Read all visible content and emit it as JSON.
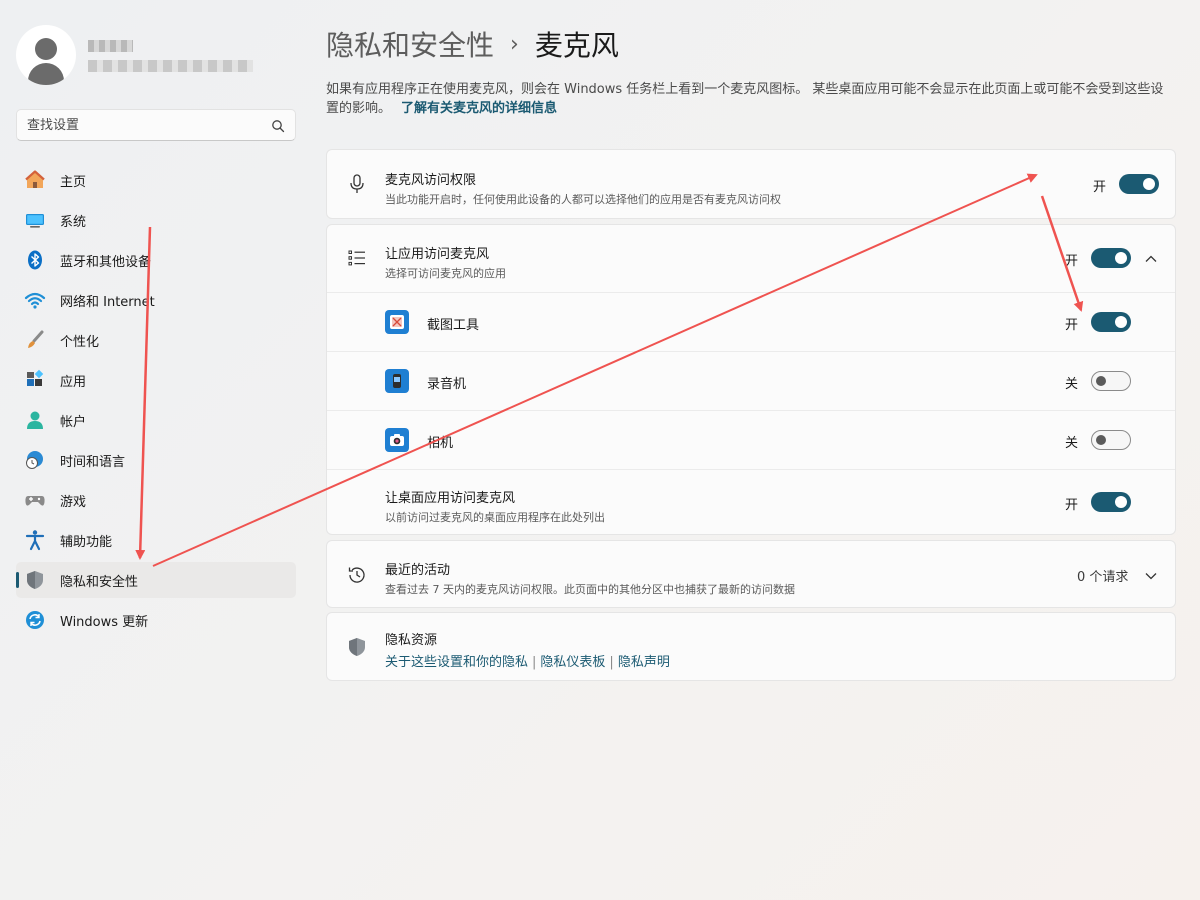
{
  "sidebar": {
    "search_placeholder": "查找设置",
    "items": [
      {
        "label": "主页",
        "icon": "home-icon"
      },
      {
        "label": "系统",
        "icon": "monitor-icon"
      },
      {
        "label": "蓝牙和其他设备",
        "icon": "bluetooth-icon"
      },
      {
        "label": "网络和 Internet",
        "icon": "wifi-icon"
      },
      {
        "label": "个性化",
        "icon": "brush-icon"
      },
      {
        "label": "应用",
        "icon": "apps-icon"
      },
      {
        "label": "帐户",
        "icon": "account-icon"
      },
      {
        "label": "时间和语言",
        "icon": "globe-clock-icon"
      },
      {
        "label": "游戏",
        "icon": "gamepad-icon"
      },
      {
        "label": "辅助功能",
        "icon": "accessibility-icon"
      },
      {
        "label": "隐私和安全性",
        "icon": "shield-icon",
        "active": true
      },
      {
        "label": "Windows 更新",
        "icon": "update-icon"
      }
    ]
  },
  "header": {
    "parent": "隐私和安全性",
    "separator": "›",
    "current": "麦克风"
  },
  "description": {
    "text": "如果有应用程序正在使用麦克风，则会在 Windows 任务栏上看到一个麦克风图标。 某些桌面应用可能不会显示在此页面上或可能不会受到这些设置的影响。",
    "link": "了解有关麦克风的详细信息"
  },
  "mic_access": {
    "title": "麦克风访问权限",
    "subtitle": "当此功能开启时，任何使用此设备的人都可以选择他们的应用是否有麦克风访问权",
    "state": "开"
  },
  "app_access": {
    "title": "让应用访问麦克风",
    "subtitle": "选择可访问麦克风的应用",
    "state": "开",
    "apps": [
      {
        "name": "截图工具",
        "state": "开",
        "on": true
      },
      {
        "name": "录音机",
        "state": "关",
        "on": false
      },
      {
        "name": "相机",
        "state": "关",
        "on": false
      }
    ],
    "desktop": {
      "title": "让桌面应用访问麦克风",
      "subtitle": "以前访问过麦克风的桌面应用程序在此处列出",
      "state": "开"
    }
  },
  "recent": {
    "title": "最近的活动",
    "subtitle": "查看过去 7 天内的麦克风访问权限。此页面中的其他分区中也捕获了最新的访问数据",
    "count": "0 个请求"
  },
  "resources": {
    "title": "隐私资源",
    "links": [
      "关于这些设置和你的隐私",
      "隐私仪表板",
      "隐私声明"
    ],
    "separator": "|"
  },
  "colors": {
    "accent": "#1b5a72",
    "annotation": "#ef5350"
  }
}
